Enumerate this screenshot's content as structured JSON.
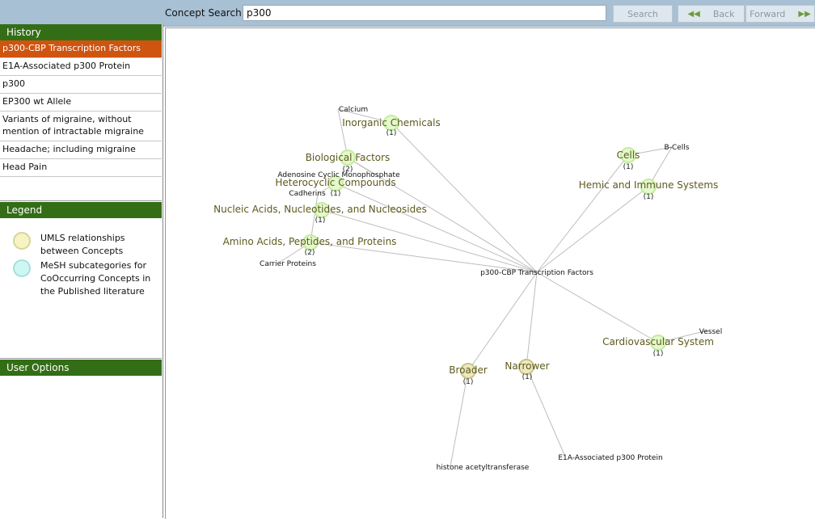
{
  "toolbar": {
    "search_label": "Concept Search:",
    "search_value": "p300",
    "search_button": "Search",
    "back_button": "Back",
    "forward_button": "Forward"
  },
  "history": {
    "title": "History",
    "items": [
      "p300-CBP Transcription Factors",
      "E1A-Associated p300 Protein",
      "p300",
      "EP300 wt Allele",
      "Variants of migraine, without mention of intractable migraine",
      "Headache; including migraine",
      "Head Pain"
    ],
    "selected_index": 0
  },
  "legend": {
    "title": "Legend",
    "items": [
      {
        "label": "UMLS relationships between Concepts",
        "color": "#f7f3c2",
        "border": "#d9d49a"
      },
      {
        "label": "MeSH subcategories for CoOccurring Concepts in the Published literature",
        "color": "#cdf7f2",
        "border": "#a6e0db"
      }
    ]
  },
  "user_options": {
    "title": "User Options"
  },
  "graph": {
    "center": "p300-CBP Transcription Factors",
    "nodes": [
      {
        "label": "Inorganic Chemicals",
        "count": "(1)",
        "kind": "mesh"
      },
      {
        "label": "Biological Factors",
        "count": "(2)",
        "kind": "mesh"
      },
      {
        "label": "Heterocyclic Compounds",
        "count": "(1)",
        "kind": "mesh"
      },
      {
        "label": "Nucleic Acids, Nucleotides, and Nucleosides",
        "count": "(1)",
        "kind": "mesh"
      },
      {
        "label": "Amino Acids, Peptides, and Proteins",
        "count": "(2)",
        "kind": "mesh"
      },
      {
        "label": "Cells",
        "count": "(1)",
        "kind": "mesh"
      },
      {
        "label": "Hemic and Immune Systems",
        "count": "(1)",
        "kind": "mesh"
      },
      {
        "label": "Cardiovascular System",
        "count": "(1)",
        "kind": "mesh"
      },
      {
        "label": "Broader",
        "count": "(1)",
        "kind": "umls"
      },
      {
        "label": "Narrower",
        "count": "(1)",
        "kind": "umls"
      }
    ],
    "leaves": [
      "Calcium",
      "Adenosine Cyclic Monophosphate",
      "Cadherins",
      "Carrier Proteins",
      "B-Cells",
      "Vessel",
      "histone acetyltransferase",
      "E1A-Associated p300 Protein"
    ],
    "colors": {
      "edge": "#bdbdbd",
      "node_text": "#5d5a1e",
      "mesh_fill": "#e4f9cc",
      "mesh_stroke": "#c4ec9e",
      "umls_fill": "#ece9c0",
      "umls_stroke": "#cbc488"
    }
  }
}
